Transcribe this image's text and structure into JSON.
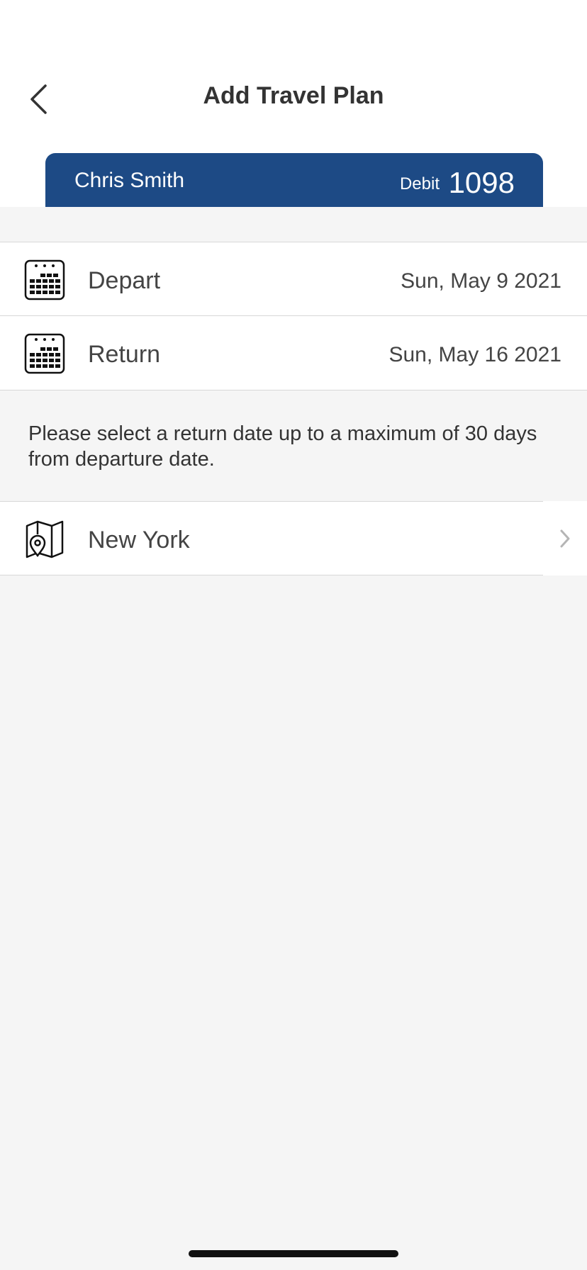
{
  "header": {
    "title": "Add Travel Plan"
  },
  "account_card": {
    "holder_name": "Chris Smith",
    "account_type": "Debit",
    "account_number": "1098",
    "color": "#1d4a85"
  },
  "dates": {
    "depart": {
      "label": "Depart",
      "value": "Sun, May 9 2021",
      "icon": "calendar-icon"
    },
    "return": {
      "label": "Return",
      "value": "Sun, May 16 2021",
      "icon": "calendar-icon"
    }
  },
  "note": "Please select a return date up to a maximum of 30 days from departure date.",
  "destination": {
    "label": "New York",
    "icon": "map-pin-icon"
  }
}
